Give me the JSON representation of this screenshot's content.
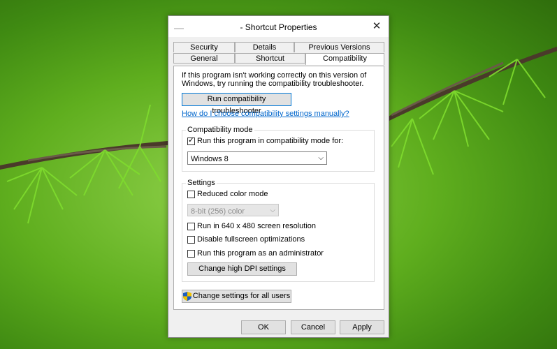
{
  "window": {
    "title": "- Shortcut Properties"
  },
  "tabs": [
    {
      "label": "Security"
    },
    {
      "label": "Details"
    },
    {
      "label": "Previous Versions"
    },
    {
      "label": "General"
    },
    {
      "label": "Shortcut"
    },
    {
      "label": "Compatibility",
      "active": true
    }
  ],
  "compat": {
    "intro": "If this program isn't working correctly on this version of Windows, try running the compatibility troubleshooter.",
    "troubleshoot_button": "Run compatibility troubleshooter",
    "help_link": "How do I choose compatibility settings manually?",
    "mode_group": {
      "title": "Compatibility mode",
      "checkbox_label": "Run this program in compatibility mode for:",
      "checked": true,
      "selected_os": "Windows 8"
    },
    "settings_group": {
      "title": "Settings",
      "reduced_color_label": "Reduced color mode",
      "color_select_value": "8-bit (256) color",
      "res_640_label": "Run in 640 x 480 screen resolution",
      "disable_fullscreen_label": "Disable fullscreen optimizations",
      "run_admin_label": "Run this program as an administrator",
      "dpi_button": "Change high DPI settings"
    },
    "all_users_button": "Change settings for all users"
  },
  "footer": {
    "ok": "OK",
    "cancel": "Cancel",
    "apply": "Apply"
  },
  "icons": {
    "close": "close-icon",
    "checkmark": "check-icon",
    "dropdown": "chevron-down-icon",
    "uac_shield": "shield-icon"
  },
  "colors": {
    "link": "#0066cc",
    "primary_border": "#0078d7",
    "desktop_green": "#6bbf2a"
  }
}
